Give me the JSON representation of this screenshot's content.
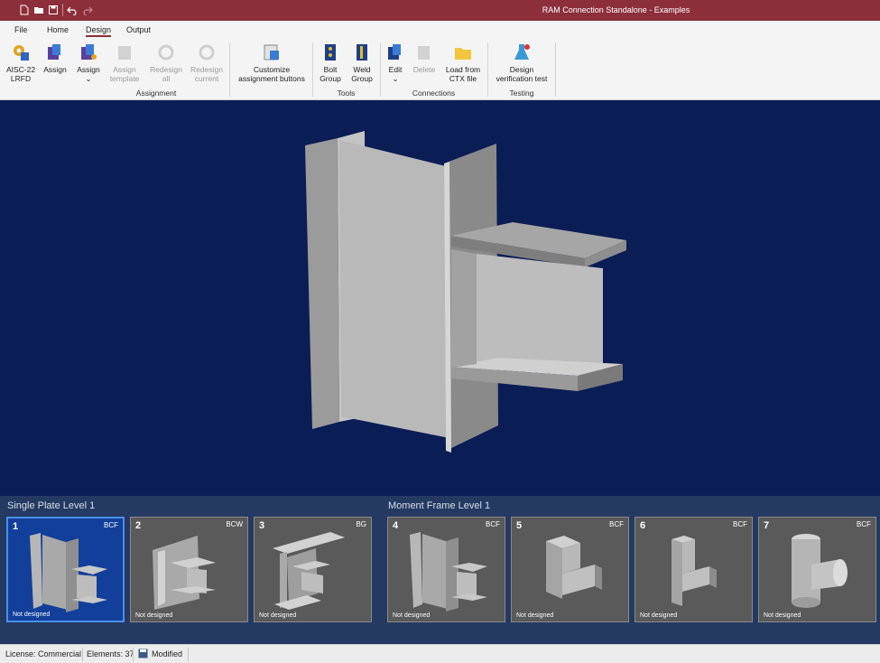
{
  "window": {
    "title": "RAM Connection Standalone - Examples"
  },
  "quick_access": [
    "new-file-icon",
    "open-folder-icon",
    "save-icon",
    "undo-icon",
    "redo-icon"
  ],
  "tabs": [
    {
      "label": "File"
    },
    {
      "label": "Home"
    },
    {
      "label": "Design",
      "active": true
    },
    {
      "label": "Output"
    }
  ],
  "ribbon": {
    "design_code": {
      "line1": "AISC-22",
      "line2": "LRFD"
    },
    "assign": {
      "label": "Assign"
    },
    "assign_menu": {
      "label": "Assign"
    },
    "assign_template": {
      "line1": "Assign",
      "line2": "template",
      "disabled": true
    },
    "redesign_all": {
      "line1": "Redesign",
      "line2": "all",
      "disabled": true
    },
    "redesign_current": {
      "line1": "Redesign",
      "line2": "current",
      "disabled": true
    },
    "customize": {
      "line1": "Customize",
      "line2": "assignment buttons"
    },
    "bolt_group": {
      "line1": "Bolt",
      "line2": "Group"
    },
    "weld_group": {
      "line1": "Weld",
      "line2": "Group"
    },
    "edit": {
      "label": "Edit"
    },
    "delete": {
      "label": "Delete",
      "disabled": true
    },
    "load_ctx": {
      "line1": "Load from",
      "line2": "CTX file"
    },
    "design_test": {
      "line1": "Design",
      "line2": "verification test"
    },
    "groups": {
      "assignment": "Assignment",
      "tools": "Tools",
      "connections": "Connections",
      "testing": "Testing"
    }
  },
  "connection_groups": [
    {
      "title": "Single Plate Level 1",
      "cards": [
        {
          "num": "1",
          "type": "BCF",
          "status": "Not designed",
          "selected": true
        },
        {
          "num": "2",
          "type": "BCW",
          "status": "Not designed"
        },
        {
          "num": "3",
          "type": "BG",
          "status": "Not designed"
        }
      ]
    },
    {
      "title": "Moment Frame Level 1",
      "cards": [
        {
          "num": "4",
          "type": "BCF",
          "status": "Not designed"
        },
        {
          "num": "5",
          "type": "BCF",
          "status": "Not designed"
        },
        {
          "num": "6",
          "type": "BCF",
          "status": "Not designed"
        },
        {
          "num": "7",
          "type": "BCF",
          "status": "Not designed"
        }
      ]
    }
  ],
  "status": {
    "license": "License: Commercial",
    "elements": "Elements: 37",
    "modified": "Modified"
  },
  "colors": {
    "titlebar": "#8c2f3b",
    "viewport": "#0b1d55",
    "panel": "#243a63",
    "selected_card": "#123f9a"
  }
}
